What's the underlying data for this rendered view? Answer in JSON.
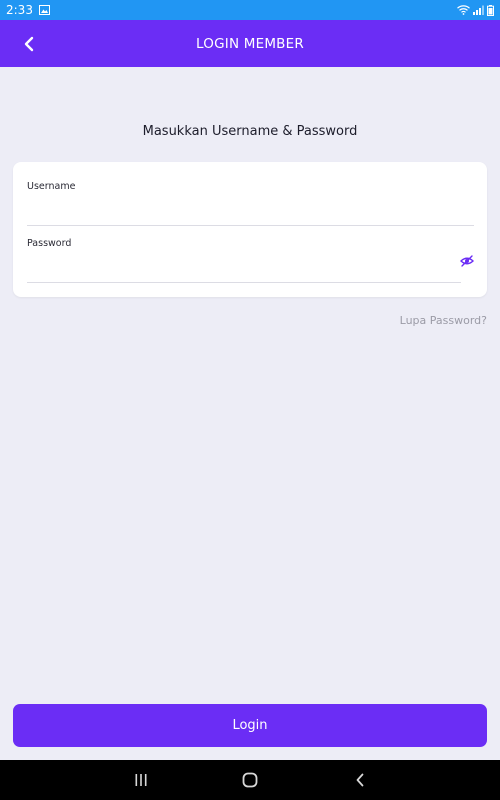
{
  "status_bar": {
    "time": "2:33",
    "icons": [
      "gallery-icon",
      "wifi-icon",
      "signal-icon",
      "battery-icon"
    ]
  },
  "app_bar": {
    "title": "LOGIN MEMBER",
    "back_icon": "chevron-left-icon",
    "color": "#6B2DF5"
  },
  "form": {
    "heading": "Masukkan Username & Password",
    "username": {
      "label": "Username",
      "value": "",
      "placeholder": ""
    },
    "password": {
      "label": "Password",
      "value": "",
      "placeholder": "",
      "toggle_icon": "eye-toggle-icon"
    },
    "forgot_password": "Lupa Password?"
  },
  "actions": {
    "login_label": "Login"
  },
  "nav_bar": {
    "icons": [
      "recent-apps-icon",
      "home-icon",
      "back-icon"
    ]
  },
  "colors": {
    "accent": "#6B2DF5",
    "status_bar": "#2196F3",
    "background": "#EDEDF6",
    "link": "#9B9BA6"
  }
}
